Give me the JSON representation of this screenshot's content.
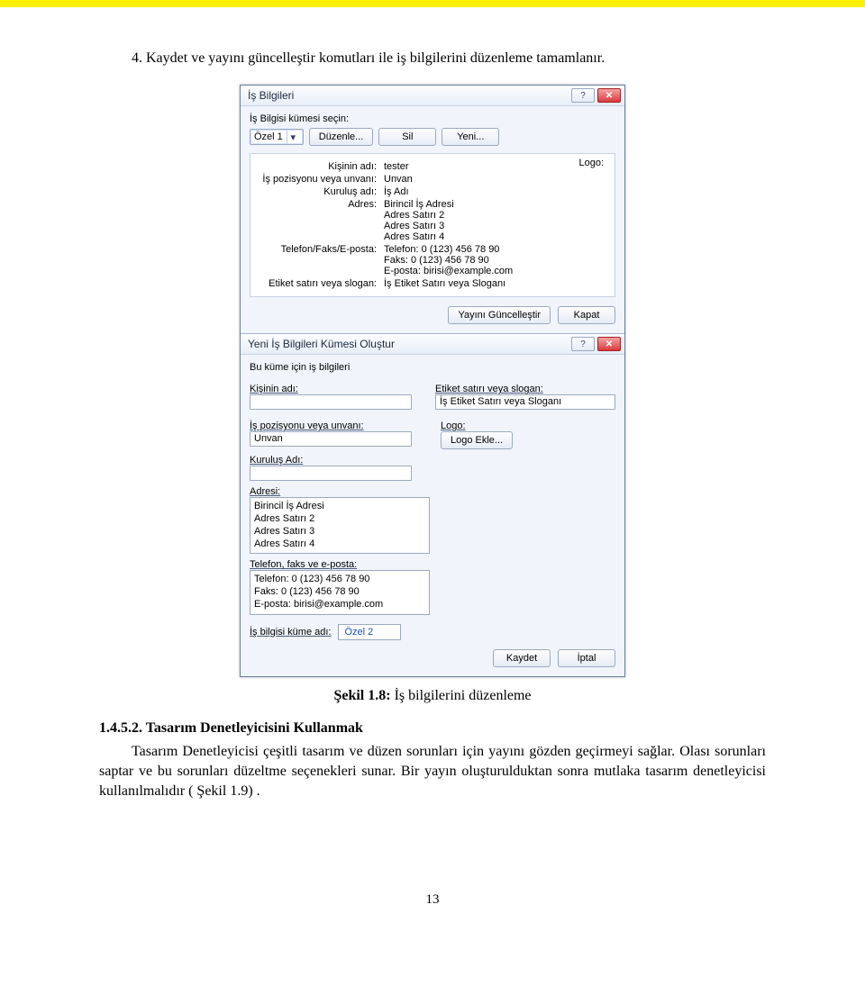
{
  "doc": {
    "first_para": "4. Kaydet ve yayını güncelleştir komutları ile iş bilgilerini düzenleme tamamlanır.",
    "caption_label": "Şekil 1.8:",
    "caption_text": " İş bilgilerini düzenleme",
    "section_num": "1.4.5.2. ",
    "section_title": "Tasarım Denetleyicisini Kullanmak",
    "body_para": "Tasarım Denetleyicisi çeşitli tasarım ve düzen sorunları için yayını gözden geçirmeyi sağlar. Olası sorunları saptar ve bu sorunları düzeltme seçenekleri sunar. Bir yayın oluşturulduktan sonra mutlaka tasarım denetleyicisi kullanılmalıdır ( Şekil 1.9) .",
    "page_number": "13"
  },
  "dlg1": {
    "title": "İş Bilgileri",
    "help_glyph": "?",
    "close_glyph": "✕",
    "select_set_label": "İş Bilgisi kümesi seçin:",
    "set_value": "Özel 1",
    "btn_edit": "Düzenle...",
    "btn_delete": "Sil",
    "btn_new": "Yeni...",
    "logo_label": "Logo:",
    "rows": {
      "person_name_k": "Kişinin adı:",
      "person_name_v": "tester",
      "position_k": "İş pozisyonu veya unvanı:",
      "position_v": "Unvan",
      "org_k": "Kuruluş adı:",
      "org_v": "İş Adı",
      "addr_k": "Adres:",
      "addr_v": "Birincil İş Adresi\nAdres Satırı 2\nAdres Satırı 3\nAdres Satırı 4",
      "tfe_k": "Telefon/Faks/E-posta:",
      "tfe_v": "Telefon: 0 (123) 456 78 90\nFaks: 0 (123) 456 78 90\nE-posta: birisi@example.com",
      "tag_k": "Etiket satırı veya slogan:",
      "tag_v": "İş Etiket Satırı veya Sloganı"
    },
    "btn_update": "Yayını Güncelleştir",
    "btn_close": "Kapat"
  },
  "dlg2": {
    "title": "Yeni İş Bilgileri Kümesi Oluştur",
    "help_glyph": "?",
    "close_glyph": "✕",
    "intro": "Bu küme için iş bilgileri",
    "person_label": "Kişinin adı:",
    "tag_label": "Etiket satırı veya slogan:",
    "tag_value": "İş Etiket Satırı veya Sloganı",
    "position_label": "İş pozisyonu veya unvanı:",
    "position_value": "Unvan",
    "logo_label": "Logo:",
    "logo_btn": "Logo Ekle...",
    "org_label": "Kuruluş Adı:",
    "addr_label": "Adresi:",
    "addr_value": "Birincil İş Adresi\nAdres Satırı 2\nAdres Satırı 3\nAdres Satırı 4",
    "tfe_label": "Telefon, faks ve e-posta:",
    "tfe_value": "Telefon: 0 (123) 456 78 90\nFaks: 0 (123) 456 78 90\nE-posta: birisi@example.com",
    "setname_label": "İş bilgisi küme adı:",
    "setname_value": "Özel 2",
    "btn_save": "Kaydet",
    "btn_cancel": "İptal"
  }
}
